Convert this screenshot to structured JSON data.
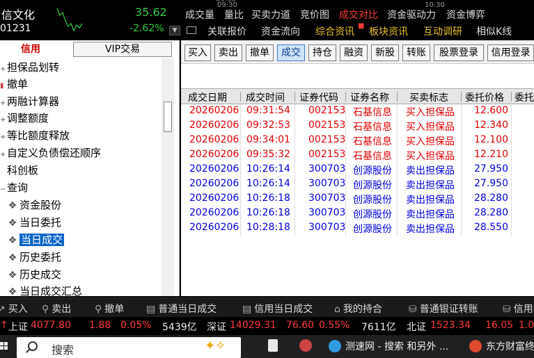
{
  "quote": {
    "name": "信文化",
    "code": "01231",
    "price": "35.62",
    "change_pct": "-2.62%",
    "top_partial": "09:30",
    "top_partial2": "10:30"
  },
  "tabs_row1": [
    "成交量",
    "量比",
    "买卖力道",
    "竞价图",
    "成交对比",
    "资金驱动力",
    "资金博弈"
  ],
  "tabs_row1_active": "成交对比",
  "tabs_row2": [
    "关联报价",
    "资金流向",
    "综合资讯",
    "板块资讯",
    "互动调研",
    "相似K线"
  ],
  "sidebar": {
    "tab_credit": "信用",
    "tab_vip": "VIP交易",
    "items": [
      {
        "label": "担保品划转",
        "icon": "collapsed"
      },
      {
        "label": "撤单",
        "icon": "document"
      },
      {
        "label": "两融计算器",
        "icon": "collapsed"
      },
      {
        "label": "调整额度",
        "icon": "collapsed"
      },
      {
        "label": "等比额度释放",
        "icon": "collapsed"
      },
      {
        "label": "自定义负债偿还顺序",
        "icon": "collapsed"
      },
      {
        "label": "科创板",
        "icon": "none"
      },
      {
        "label": "查询",
        "icon": "expanded"
      },
      {
        "label": "资金股份",
        "icon": "query"
      },
      {
        "label": "当日委托",
        "icon": "query"
      },
      {
        "label": "当日成交",
        "icon": "query",
        "selected": true
      },
      {
        "label": "历史委托",
        "icon": "query"
      },
      {
        "label": "历史成交",
        "icon": "query"
      },
      {
        "label": "当日成交汇总",
        "icon": "query"
      }
    ]
  },
  "toolbar": [
    "买入",
    "卖出",
    "撤单",
    "成交",
    "持仓",
    "融资",
    "新股",
    "转账",
    "股票登录",
    "信用登录"
  ],
  "toolbar_active": "成交",
  "table": {
    "headers": [
      "成交日期",
      "成交时间",
      "证券代码",
      "证券名称",
      "买卖标志",
      "委托价格",
      "委托"
    ],
    "rows": [
      {
        "date": "20260206",
        "time": "09:31:54",
        "code": "002153",
        "name": "石基信息",
        "side": "买入担保品",
        "price": "12.600",
        "type": "buy"
      },
      {
        "date": "20260206",
        "time": "09:32:53",
        "code": "002153",
        "name": "石基信息",
        "side": "买入担保品",
        "price": "12.340",
        "type": "buy"
      },
      {
        "date": "20260206",
        "time": "09:34:01",
        "code": "002153",
        "name": "石基信息",
        "side": "买入担保品",
        "price": "12.100",
        "type": "buy"
      },
      {
        "date": "20260206",
        "time": "09:35:32",
        "code": "002153",
        "name": "石基信息",
        "side": "买入担保品",
        "price": "12.210",
        "type": "buy"
      },
      {
        "date": "20260206",
        "time": "10:26:14",
        "code": "300703",
        "name": "创源股份",
        "side": "卖出担保品",
        "price": "27.950",
        "type": "sell"
      },
      {
        "date": "20260206",
        "time": "10:26:14",
        "code": "300703",
        "name": "创源股份",
        "side": "卖出担保品",
        "price": "27.950",
        "type": "sell"
      },
      {
        "date": "20260206",
        "time": "10:26:18",
        "code": "300703",
        "name": "创源股份",
        "side": "卖出担保品",
        "price": "28.280",
        "type": "sell"
      },
      {
        "date": "20260206",
        "time": "10:26:18",
        "code": "300703",
        "name": "创源股份",
        "side": "卖出担保品",
        "price": "28.280",
        "type": "sell"
      },
      {
        "date": "20260206",
        "time": "10:28:18",
        "code": "300703",
        "name": "创源股份",
        "side": "卖出担保品",
        "price": "28.550",
        "type": "sell"
      }
    ]
  },
  "quickbar": [
    "买入",
    "卖出",
    "撤单",
    "普通当日成交",
    "信用当日成交",
    "我的持合",
    "普通银证转账",
    "信用"
  ],
  "ticker": {
    "sh_name": "上证",
    "sh_val": "4077.80",
    "sh_chg": "1.88",
    "sh_pct": "0.05%",
    "sh_amt": "5439亿",
    "sz_name": "深证",
    "sz_val": "14029.31",
    "sz_chg": "76.60",
    "sz_pct": "0.55%",
    "sz_amt": "7611亿",
    "bz_name": "北证",
    "bz_val": "1523.34",
    "bz_chg": "16.05",
    "bz_pct": "1.0"
  },
  "taskbar": {
    "search_text": "搜索",
    "app1": "测速网 - 搜索 和另外 ...",
    "app2": "东方财富终"
  },
  "colors": {
    "buy": "#e00000",
    "sell": "#0000e0",
    "up": "#ff3b3b",
    "down": "#2ecc40",
    "selected": "#0a64c8"
  }
}
